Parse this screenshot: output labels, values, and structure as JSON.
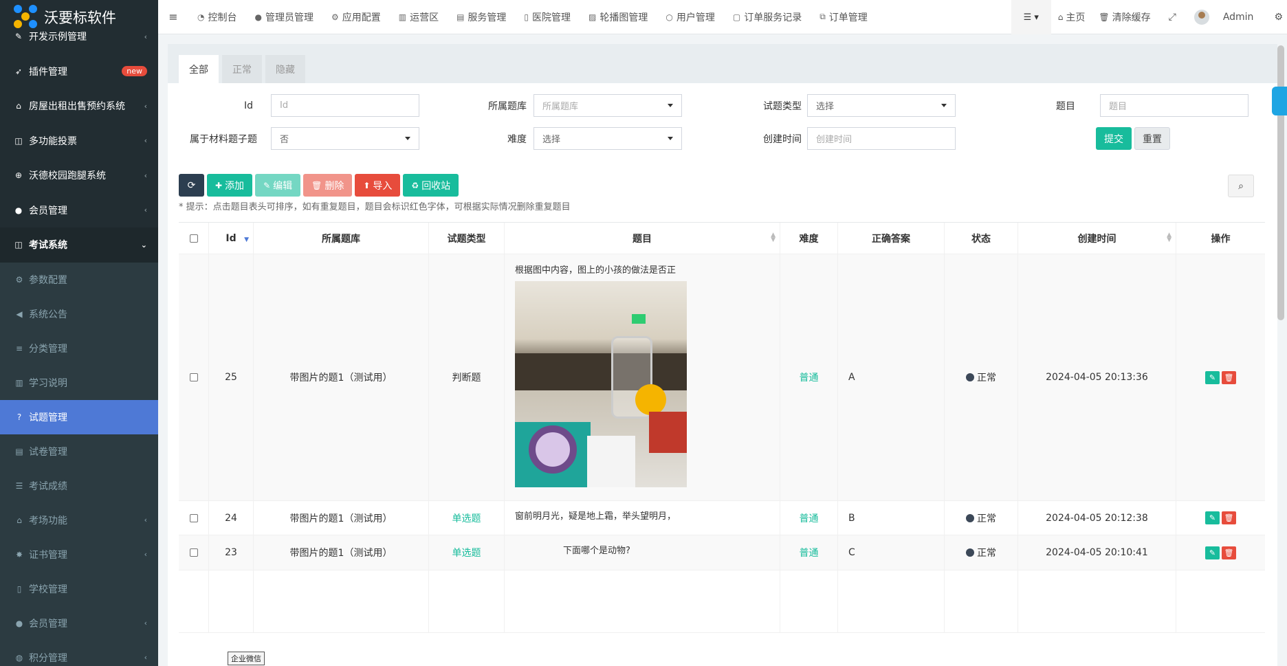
{
  "app": {
    "title": "沃要标软件"
  },
  "sidebar": {
    "items": [
      {
        "label": "开发示例管理",
        "icon": "pencil-icon",
        "chevron": "‹"
      },
      {
        "label": "插件管理",
        "icon": "rocket-icon",
        "badge": "new"
      },
      {
        "label": "房屋出租出售预约系统",
        "icon": "home-icon",
        "chevron": "‹"
      },
      {
        "label": "多功能投票",
        "icon": "columns-icon",
        "chevron": "‹"
      },
      {
        "label": "沃德校园跑腿系统",
        "icon": "lock-icon",
        "chevron": "‹"
      },
      {
        "label": "会员管理",
        "icon": "user-icon",
        "chevron": "‹"
      },
      {
        "label": "考试系统",
        "icon": "columns-icon",
        "chevron": "⌄"
      }
    ],
    "sub_items": [
      {
        "label": "参数配置",
        "icon": "cogs-icon"
      },
      {
        "label": "系统公告",
        "icon": "volume-icon"
      },
      {
        "label": "分类管理",
        "icon": "align-icon"
      },
      {
        "label": "学习说明",
        "icon": "map-icon"
      },
      {
        "label": "试题管理",
        "icon": "question-icon",
        "active": true
      },
      {
        "label": "试卷管理",
        "icon": "newspaper-icon"
      },
      {
        "label": "考试成绩",
        "icon": "list-icon"
      },
      {
        "label": "考场功能",
        "icon": "home-icon",
        "chevron": "‹"
      },
      {
        "label": "证书管理",
        "icon": "certificate-icon",
        "chevron": "‹"
      },
      {
        "label": "学校管理",
        "icon": "building-icon"
      },
      {
        "label": "会员管理",
        "icon": "user-icon",
        "chevron": "‹"
      },
      {
        "label": "积分管理",
        "icon": "database-icon",
        "chevron": "‹"
      }
    ]
  },
  "header": {
    "nav": [
      {
        "label": "控制台",
        "icon": "dashboard-icon"
      },
      {
        "label": "管理员管理",
        "icon": "user-icon"
      },
      {
        "label": "应用配置",
        "icon": "gear-icon"
      },
      {
        "label": "运营区",
        "icon": "map-icon"
      },
      {
        "label": "服务管理",
        "icon": "list-icon"
      },
      {
        "label": "医院管理",
        "icon": "hospital-icon"
      },
      {
        "label": "轮播图管理",
        "icon": "image-icon"
      },
      {
        "label": "用户管理",
        "icon": "user-o-icon"
      },
      {
        "label": "订单服务记录",
        "icon": "file-icon"
      },
      {
        "label": "订单管理",
        "icon": "clone-icon"
      }
    ],
    "home_label": "主页",
    "clear_cache_label": "清除缓存",
    "user_name": "Admin"
  },
  "tabs": [
    "全部",
    "正常",
    "隐藏"
  ],
  "filters": {
    "id": {
      "label": "Id",
      "placeholder": "Id"
    },
    "bank": {
      "label": "所属题库",
      "value": "所属题库"
    },
    "type": {
      "label": "试题类型",
      "value": "选择"
    },
    "title": {
      "label": "题目",
      "placeholder": "题目"
    },
    "material": {
      "label": "属于材料题子题",
      "value": "否"
    },
    "difficulty": {
      "label": "难度",
      "value": "选择"
    },
    "created": {
      "label": "创建时间",
      "placeholder": "创建时间"
    },
    "submit_label": "提交",
    "reset_label": "重置"
  },
  "toolbar": {
    "refresh_icon": "refresh-icon",
    "add_label": "添加",
    "edit_label": "编辑",
    "delete_label": "删除",
    "import_label": "导入",
    "recycle_label": "回收站",
    "hint": "* 提示：点击题目表头可排序，如有重复题目，题目会标识红色字体，可根据实际情况删除重复题目"
  },
  "table": {
    "columns": [
      "Id",
      "所属题库",
      "试题类型",
      "题目",
      "难度",
      "正确答案",
      "状态",
      "创建时间",
      "操作"
    ],
    "rows": [
      {
        "id": "25",
        "bank": "带图片的题1（测试用）",
        "type": "判断题",
        "title": "根据图中内容，图上的小孩的做法是否正",
        "difficulty": "普通",
        "answer": "A",
        "status": "正常",
        "created": "2024-04-05 20:13:36",
        "has_image": true
      },
      {
        "id": "24",
        "bank": "带图片的题1（测试用）",
        "type": "单选题",
        "title": "窗前明月光，疑是地上霜，举头望明月，",
        "difficulty": "普通",
        "answer": "B",
        "status": "正常",
        "created": "2024-04-05 20:12:38"
      },
      {
        "id": "23",
        "bank": "带图片的题1（测试用）",
        "type": "单选题",
        "title": "下面哪个是动物?",
        "difficulty": "普通",
        "answer": "C",
        "status": "正常",
        "created": "2024-04-05 20:10:41"
      }
    ]
  },
  "tooltip": "企业微信",
  "colors": {
    "accent": "#18bc9c",
    "danger": "#e74c3c",
    "active_menu": "#4e79d6",
    "sidebar": "#222d32"
  }
}
